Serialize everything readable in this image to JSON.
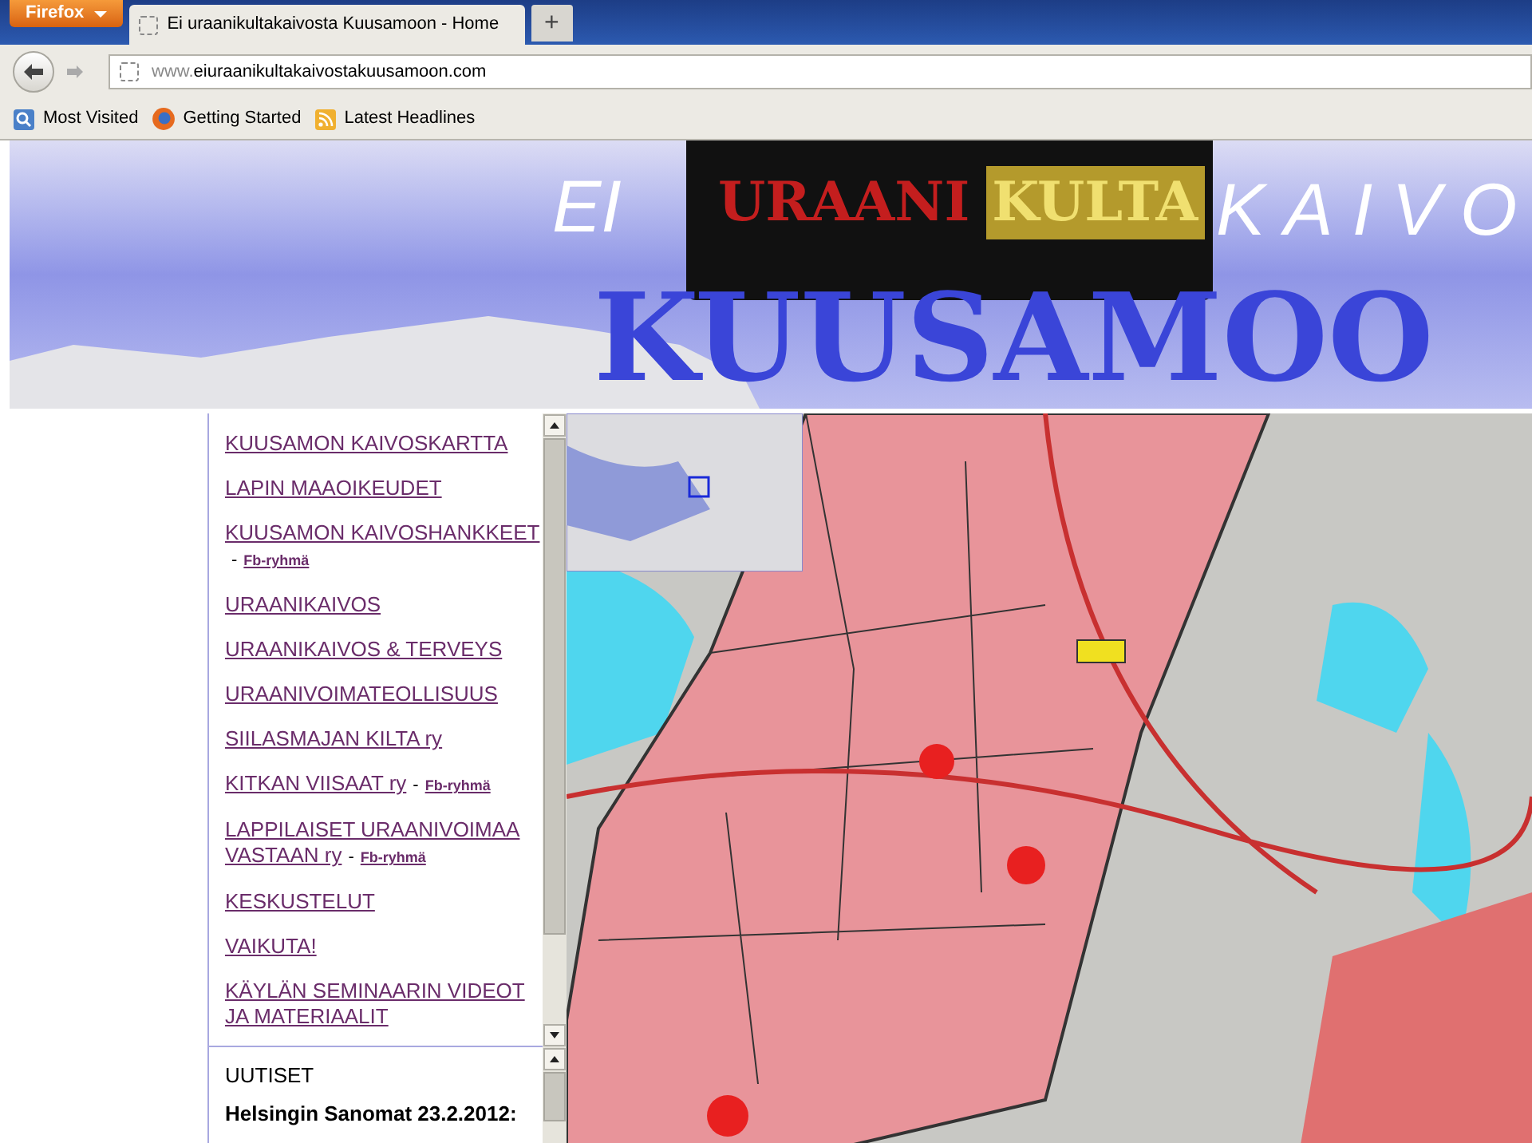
{
  "browser": {
    "app_button": "Firefox",
    "tabs": [
      {
        "title": "Ei uraanikultakaivosta Kuusamoon - Home",
        "selected": true
      }
    ],
    "new_tab": "+",
    "url_prefix": "www.",
    "url_domain": "eiuraanikultakaivostakuusamoon.com",
    "bookmarks": [
      {
        "label": "Most Visited",
        "kind": "search"
      },
      {
        "label": "Getting Started",
        "kind": "firefox"
      },
      {
        "label": "Latest Headlines",
        "kind": "feed"
      }
    ]
  },
  "banner": {
    "word_1": "EI",
    "word_2": "URAANI",
    "word_3": "KULTA",
    "word_4": "KAIVO",
    "word_5": "KUUSAMOO"
  },
  "menu": {
    "items": [
      {
        "lines": [
          "KUUSAMON KAIVOSKARTTA"
        ]
      },
      {
        "lines": [
          "LAPIN MAAOIKEUDET"
        ]
      },
      {
        "lines": [
          "KUUSAMON KAIVOSHANKKEET"
        ],
        "separator": "-",
        "sublink": "Fb-ryhmä"
      },
      {
        "lines": [
          "URAANIKAIVOS"
        ]
      },
      {
        "lines": [
          "URAANIKAIVOS & TERVEYS"
        ]
      },
      {
        "lines": [
          "URAANIVOIMATEOLLISUUS"
        ]
      },
      {
        "lines": [
          "SIILASMAJAN KILTA ry"
        ]
      },
      {
        "lines": [
          "KITKAN VIISAAT ry"
        ],
        "separator": "-",
        "sublink": "Fb-ryhmä"
      },
      {
        "lines": [
          "LAPPILAISET URAANIVOIMAA",
          "VASTAAN ry"
        ],
        "separator": "-",
        "sublink": "Fb-ryhmä"
      },
      {
        "lines": [
          "KESKUSTELUT"
        ]
      },
      {
        "lines": [
          "VAIKUTA!"
        ]
      },
      {
        "lines": [
          "KÄYLÄN SEMINAARIN VIDEOT",
          "JA MATERIAALIT"
        ]
      }
    ]
  },
  "news": {
    "title": "UUTISET",
    "headline": "Helsingin Sanomat 23.2.2012:"
  }
}
